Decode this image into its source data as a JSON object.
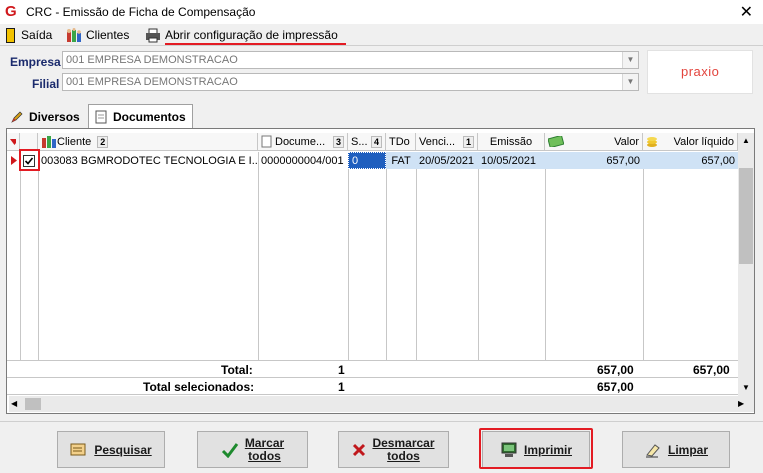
{
  "window": {
    "title": "CRC - Emissão de Ficha de Compensação",
    "close": "✕",
    "app_icon": "G"
  },
  "menu": {
    "saida": "Saída",
    "clientes": "Clientes",
    "config": "Abrir configuração de impressão"
  },
  "form": {
    "empresa_label": "Empresa",
    "empresa_value": "001 EMPRESA DEMONSTRACAO",
    "filial_label": "Filial",
    "filial_value": "001 EMPRESA DEMONSTRACAO",
    "logo": "praxio"
  },
  "tabs": {
    "diversos": "Diversos",
    "documentos": "Documentos"
  },
  "grid": {
    "headers": {
      "cliente": "Cliente",
      "cliente_sort": "2",
      "documento": "Docume...",
      "documento_sort": "3",
      "s": "S...",
      "s_sort": "4",
      "tdo": "TDo",
      "venc": "Venci...",
      "venc_sort": "1",
      "emissao": "Emissão",
      "valor": "Valor",
      "valor_liquido": "Valor líquido"
    },
    "row": {
      "cliente": "003083 BGMRODOTEC TECNOLOGIA  E I...",
      "documento": "0000000004/001",
      "s": "0",
      "tdo": "FAT",
      "vencimento": "20/05/2021",
      "emissao": "10/05/2021",
      "valor": "657,00",
      "valor_liquido": "657,00"
    },
    "totals": {
      "total_label": "Total:",
      "total_count": "1",
      "total_valor": "657,00",
      "total_liquido": "657,00",
      "sel_label": "Total selecionados:",
      "sel_count": "1",
      "sel_valor": "657,00"
    }
  },
  "buttons": {
    "pesquisar": "Pesquisar",
    "marcar_1": "Marcar",
    "marcar_2": "todos",
    "desmarcar_1": "Desmarcar",
    "desmarcar_2": "todos",
    "imprimir": "Imprimir",
    "limpar": "Limpar"
  }
}
